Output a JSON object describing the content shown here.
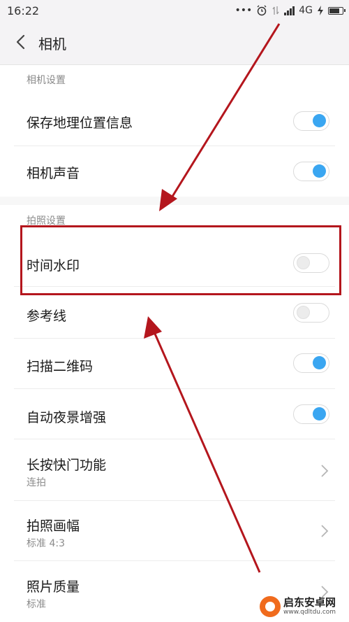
{
  "status_bar": {
    "time": "16:22",
    "dots": "•••",
    "network": "4G",
    "icons": [
      "alarm-icon",
      "data-arrows-icon",
      "signal-icon",
      "charging-icon",
      "battery-icon"
    ]
  },
  "header": {
    "title": "相机",
    "back_icon": "chevron-left-icon"
  },
  "sections": [
    {
      "label": "相机设置",
      "items": [
        {
          "title": "保存地理位置信息",
          "control": "switch",
          "on": true
        },
        {
          "title": "相机声音",
          "control": "switch",
          "on": true
        }
      ]
    },
    {
      "label": "拍照设置",
      "items": [
        {
          "title": "时间水印",
          "control": "switch",
          "on": false,
          "highlighted": true
        },
        {
          "title": "参考线",
          "control": "switch",
          "on": false
        },
        {
          "title": "扫描二维码",
          "control": "switch",
          "on": true
        },
        {
          "title": "自动夜景增强",
          "control": "switch",
          "on": true
        },
        {
          "title": "长按快门功能",
          "subtitle": "连拍",
          "control": "chevron"
        },
        {
          "title": "拍照画幅",
          "subtitle": "标准 4:3",
          "control": "chevron"
        },
        {
          "title": "照片质量",
          "subtitle": "标准",
          "control": "chevron"
        }
      ]
    }
  ],
  "annotation": {
    "highlight_color": "#b4161d",
    "arrow_color": "#b4161d"
  },
  "colors": {
    "switch_on": "#3aa6f1",
    "header_bg": "#f4f3f5"
  },
  "watermark": {
    "name": "启东安卓网",
    "url": "www.qdltdu.com"
  }
}
